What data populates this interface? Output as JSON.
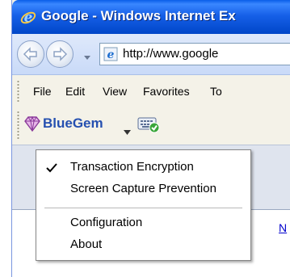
{
  "window": {
    "title": "Google - Windows Internet Ex",
    "titlebar_color": "#1660e8"
  },
  "address_bar": {
    "url": "http://www.google"
  },
  "menubar": {
    "items": [
      "File",
      "Edit",
      "View",
      "Favorites",
      "To"
    ]
  },
  "bluegem_toolbar": {
    "label": "BlueGem",
    "label_color": "#2550b0"
  },
  "popup_menu": {
    "items": [
      {
        "label": "Transaction Encryption",
        "checked": true
      },
      {
        "label": "Screen Capture Prevention",
        "checked": false
      },
      {
        "label": "Configuration",
        "checked": false
      },
      {
        "label": "About",
        "checked": false
      }
    ]
  },
  "content": {
    "link_fragment": "N"
  }
}
